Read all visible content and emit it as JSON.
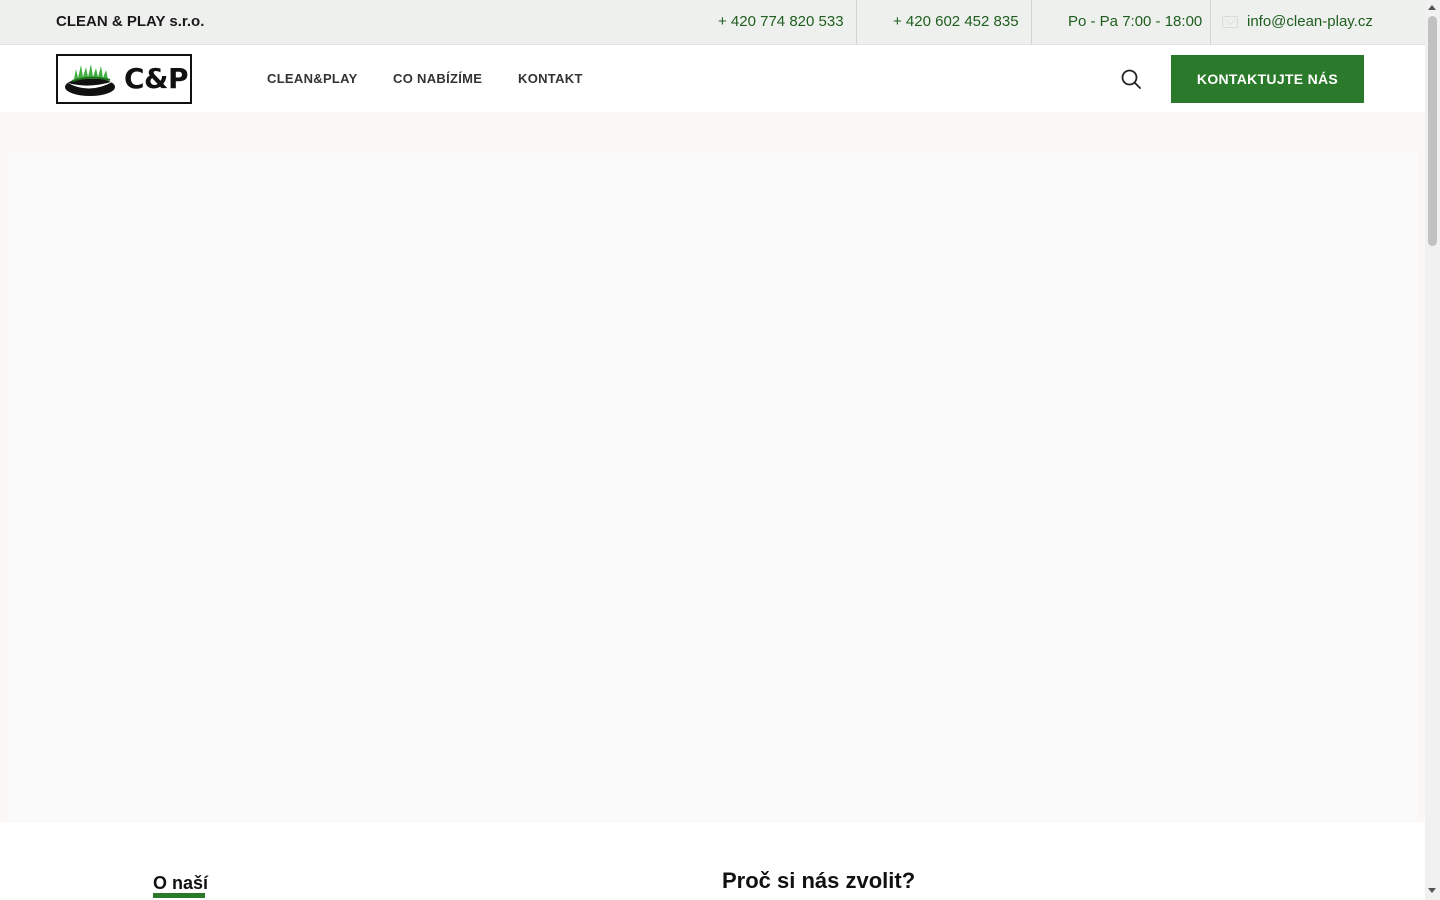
{
  "topbar": {
    "company": "CLEAN & PLAY s.r.o.",
    "phone1": "+ 420 774 820 533",
    "phone2": "+ 420 602 452 835",
    "hours": "Po - Pa 7:00 - 18:00",
    "email": "info@clean-play.cz",
    "icons": [
      "mail-icon"
    ]
  },
  "header": {
    "logo_text": "C&P",
    "nav": [
      {
        "label": "CLEAN&PLAY"
      },
      {
        "label": "CO NABÍZÍME"
      },
      {
        "label": "KONTAKT"
      }
    ],
    "search_icon": "search-icon",
    "cta_label": "KONTAKTUJTE NÁS"
  },
  "sections": {
    "about_title": "O naší",
    "why_title": "Proč si nás zvolit?"
  },
  "colors": {
    "accent": "#2b7a2b",
    "topbar_bg": "#eef0ee",
    "hero_bg": "#faf7f4",
    "link_green": "#1f5e1f"
  }
}
